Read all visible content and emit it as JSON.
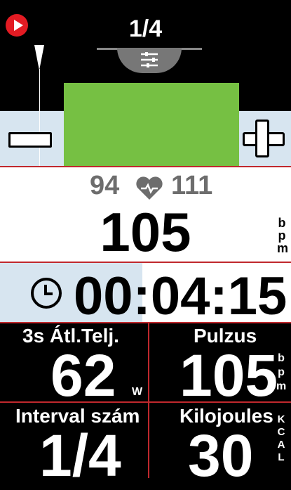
{
  "header": {
    "page_indicator": "1/4"
  },
  "heart_rate": {
    "min": "94",
    "max": "111",
    "current": "105",
    "unit_letters": [
      "b",
      "p",
      "m"
    ]
  },
  "timer": {
    "value": "00:04:15"
  },
  "fields": [
    {
      "label": "3s Átl.Telj.",
      "value": "62",
      "unit": "W"
    },
    {
      "label": "Pulzus",
      "value": "105",
      "unit_letters": [
        "b",
        "p",
        "m"
      ]
    },
    {
      "label": "Interval szám",
      "value": "1/4"
    },
    {
      "label": "Kilojoules",
      "value": "30",
      "unit_letters": [
        "K",
        "C",
        "A",
        "L"
      ]
    }
  ],
  "colors": {
    "accent_red": "#c0282d",
    "zone_green": "#76c043",
    "band_blue": "#d7e5f0",
    "play_red": "#e31b23"
  }
}
